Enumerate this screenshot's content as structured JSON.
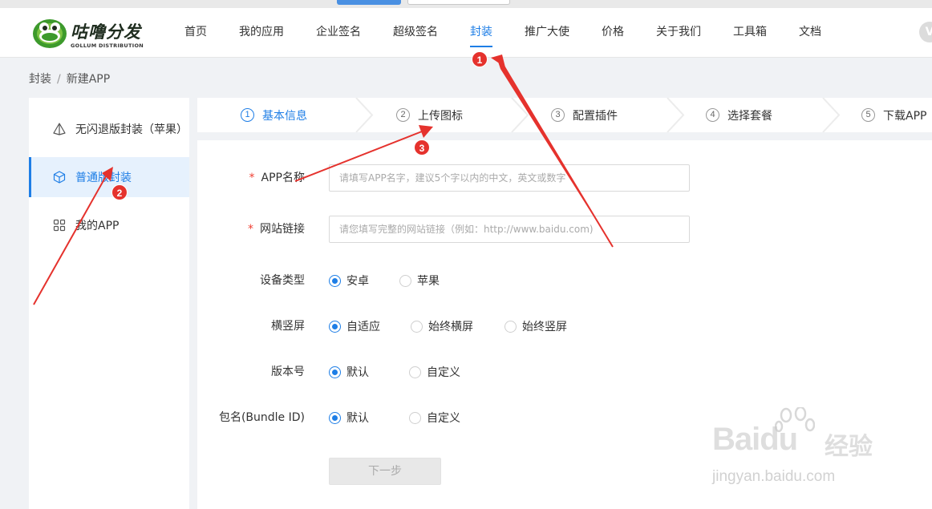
{
  "header": {
    "logo_text": "咕噜分发",
    "logo_sub": "GOLLUM DISTRIBUTION",
    "nav": [
      {
        "label": "首页"
      },
      {
        "label": "我的应用"
      },
      {
        "label": "企业签名"
      },
      {
        "label": "超级签名"
      },
      {
        "label": "封装",
        "active": true
      },
      {
        "label": "推广大使"
      },
      {
        "label": "价格"
      },
      {
        "label": "关于我们"
      },
      {
        "label": "工具箱"
      },
      {
        "label": "文档"
      }
    ],
    "corner_icon": "V"
  },
  "breadcrumb": {
    "root": "封装",
    "separator": "/",
    "current": "新建APP"
  },
  "sidebar": {
    "items": [
      {
        "label": "无闪退版封装（苹果）",
        "icon": "pyramid-icon"
      },
      {
        "label": "普通版封装",
        "icon": "cube-icon",
        "active": true
      },
      {
        "label": "我的APP",
        "icon": "grid-icon"
      }
    ]
  },
  "steps": [
    {
      "num": "1",
      "label": "基本信息",
      "active": true
    },
    {
      "num": "2",
      "label": "上传图标"
    },
    {
      "num": "3",
      "label": "配置插件"
    },
    {
      "num": "4",
      "label": "选择套餐"
    },
    {
      "num": "5",
      "label": "下载APP"
    }
  ],
  "form": {
    "app_name": {
      "label": "APP名称",
      "required": "*",
      "placeholder": "请填写APP名字，建议5个字以内的中文，英文或数字",
      "value": ""
    },
    "site_url": {
      "label": "网站链接",
      "required": "*",
      "placeholder": "请您填写完整的网站链接（例如：http://www.baidu.com)",
      "value": ""
    },
    "device_type": {
      "label": "设备类型",
      "options": [
        {
          "label": "安卓",
          "checked": true
        },
        {
          "label": "苹果",
          "checked": false
        }
      ]
    },
    "orientation": {
      "label": "横竖屏",
      "options": [
        {
          "label": "自适应",
          "checked": true
        },
        {
          "label": "始终横屏",
          "checked": false
        },
        {
          "label": "始终竖屏",
          "checked": false
        }
      ]
    },
    "version": {
      "label": "版本号",
      "options": [
        {
          "label": "默认",
          "checked": true
        },
        {
          "label": "自定义",
          "checked": false
        }
      ]
    },
    "bundle_id": {
      "label": "包名(Bundle ID)",
      "options": [
        {
          "label": "默认",
          "checked": true
        },
        {
          "label": "自定义",
          "checked": false
        }
      ]
    },
    "next_label": "下一步"
  },
  "annotations": {
    "badges": [
      "1",
      "2",
      "3"
    ],
    "color": "#e5322d"
  },
  "watermark": {
    "brand": "Baidu",
    "cn": "经验",
    "url": "jingyan.baidu.com"
  },
  "colors": {
    "accent": "#1e7ee6",
    "required": "#f04134",
    "annotation": "#e5322d"
  }
}
